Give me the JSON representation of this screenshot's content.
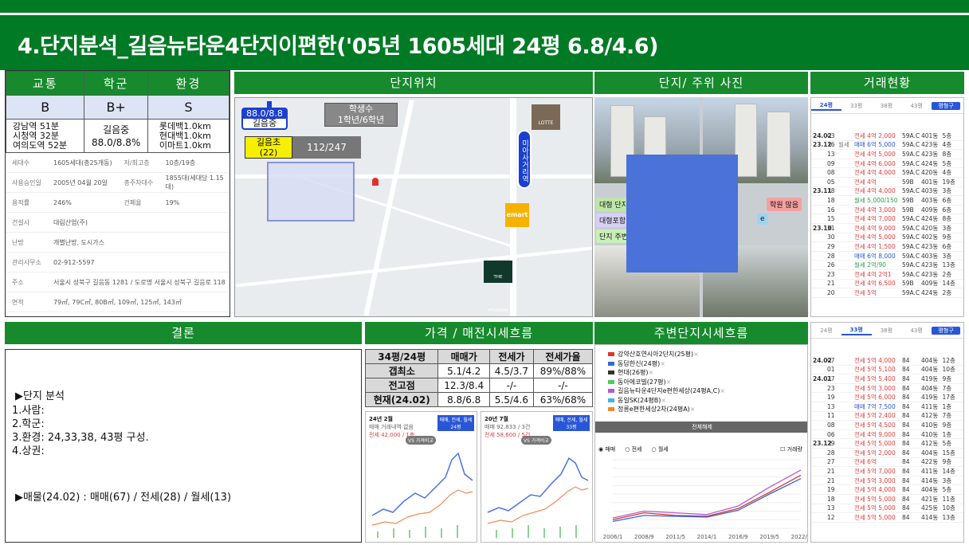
{
  "title": "4.단지분석_길음뉴타운4단지이편한('05년 1605세대 24평 6.8/4.6)",
  "grade": {
    "headers": [
      "교통",
      "학군",
      "환경"
    ],
    "grades": [
      "B",
      "B+",
      "S"
    ],
    "transport": [
      "강남역 51분",
      "시청역 32분",
      "여의도역 52분"
    ],
    "school": [
      "길음중",
      "88.0/8.8%"
    ],
    "environment": [
      "롯데백1.0km",
      "현대백1.0km",
      "이마트1.0km"
    ]
  },
  "complex_info": [
    {
      "k": "세대수",
      "v": "1605세대(총25개동)",
      "k2": "저/최고층",
      "v2": "10층/19층"
    },
    {
      "k": "사용승인일",
      "v": "2005년 04월 20일",
      "k2": "총주차대수",
      "v2": "1855대(세대당 1.15대)"
    },
    {
      "k": "용적률",
      "v": "246%",
      "k2": "건폐율",
      "v2": "19%"
    },
    {
      "k": "건설사",
      "v": "대림산업(주)",
      "k2": "",
      "v2": ""
    },
    {
      "k": "난방",
      "v": "개별난방, 도시가스",
      "k2": "",
      "v2": ""
    },
    {
      "k": "관리사무소",
      "v": "02-912-5597",
      "k2": "",
      "v2": ""
    },
    {
      "k": "주소",
      "v": "서울시 성북구 길음동 1281 / 도로명 서울시 성북구 길음로 118",
      "k2": "",
      "v2": ""
    },
    {
      "k": "면적",
      "v": "79㎡, 79C㎡, 80B㎡, 109㎡, 125㎡, 143㎡",
      "k2": "",
      "v2": ""
    }
  ],
  "sections": {
    "location": "단지위치",
    "photos": "단지/ 주위 사진",
    "trade": "거래현황",
    "conclusion": "결론",
    "price": "가격 / 매전시세흐름",
    "surround": "주변단지시세흐름"
  },
  "map": {
    "school_score": "88.0/8.8",
    "school_name": "길음중",
    "students_label": "학생수",
    "students": "1학년/6학년",
    "elem_name": "길음초",
    "elem_count": "(22)",
    "elem_ratio": "112/247",
    "station": "미아사거리역",
    "mart": "emart",
    "lotte": "LOTTE",
    "hyundai": "THE HYUNDAI"
  },
  "photo_labels": [
    "대형 단지",
    "대형포함",
    "단지 주변",
    "학원 많음",
    "e"
  ],
  "conclusion": {
    "heading": "▶단지 분석",
    "items": [
      "1.사람:",
      "2.학군:",
      "3.환경: 24,33,38, 43평 구성.",
      "4.상권:"
    ],
    "listing": "▶매물(24.02) : 매매(67) / 전세(28) / 월세(13)"
  },
  "price_table": {
    "headers": [
      "34평/24평",
      "매매가",
      "전세가",
      "전세가율"
    ],
    "rows": [
      [
        "갭최소",
        "5.1/4.2",
        "4.5/3.7",
        "89%/88%"
      ],
      [
        "전고점",
        "12.3/8.4",
        "-/-",
        "-/-"
      ],
      [
        "현재(24.02)",
        "8.8/6.8",
        "5.5/4.6",
        "63%/68%"
      ]
    ]
  },
  "mini1": {
    "head": "24년 2월",
    "sub": "매매 거래내역 없음",
    "price": "전세 42,000 / 1층",
    "btn": "매매, 전세, 월세",
    "btn2": "24평",
    "vs": "VS 가격비교"
  },
  "mini2": {
    "head": "20년 7월",
    "sub": "매매 92,833 / 3건",
    "price": "전세 58,600 / 5건",
    "btn": "매매, 전세, 월세",
    "btn2": "33평",
    "vs": "VS 가격비교"
  },
  "trade1": {
    "tabs": [
      "24평",
      "33평",
      "38평",
      "43평"
    ],
    "btn": "평형구",
    "rows": [
      [
        "24.02",
        "03",
        "",
        "전세 4억 2,000",
        "59A.C",
        "401동",
        "5층"
      ],
      [
        "23.12",
        "16",
        "월세",
        "매매 6억 5,000",
        "59A.C",
        "423동",
        "4층"
      ],
      [
        "",
        "13",
        "",
        "전세 4억 5,000",
        "59A.C",
        "423동",
        "8층"
      ],
      [
        "",
        "09",
        "",
        "전세 4억 6,000",
        "59A.C",
        "424동",
        "5층"
      ],
      [
        "",
        "08",
        "",
        "전세 4억 4,000",
        "59A.C",
        "420동",
        "4층"
      ],
      [
        "",
        "05",
        "",
        "전세 4억",
        "59B",
        "401동",
        "19층"
      ],
      [
        "23.11",
        "18",
        "",
        "전세 4억 4,000",
        "59A.C",
        "403동",
        "3층"
      ],
      [
        "",
        "18",
        "",
        "월세 5,000/150",
        "59B",
        "403동",
        "6층"
      ],
      [
        "",
        "16",
        "",
        "전세 4억 3,000",
        "59B",
        "409동",
        "6층"
      ],
      [
        "",
        "15",
        "",
        "전세 4억 7,000",
        "59A.C",
        "424동",
        "8층"
      ],
      [
        "23.10",
        "31",
        "",
        "전세 4억 9,000",
        "59A.C",
        "420동",
        "3층"
      ],
      [
        "",
        "30",
        "",
        "전세 4억 5,000",
        "59A.C",
        "402동",
        "9층"
      ],
      [
        "",
        "29",
        "",
        "전세 4억 1,500",
        "59A.C",
        "423동",
        "6층"
      ],
      [
        "",
        "28",
        "",
        "매매 6억 8,000",
        "59A.C",
        "403동",
        "3층"
      ],
      [
        "",
        "26",
        "",
        "월세 2억/90",
        "59A.C",
        "423동",
        "13층"
      ],
      [
        "",
        "23",
        "",
        "전세 4억 2억1",
        "59A.C",
        "423동",
        "2층"
      ],
      [
        "",
        "21",
        "",
        "전세 4억 6,500",
        "59B",
        "409동",
        "14층"
      ],
      [
        "",
        "20",
        "",
        "전세 5억",
        "59A.C",
        "424동",
        "2층"
      ]
    ]
  },
  "trade2": {
    "tabs": [
      "24평",
      "33평",
      "38평",
      "43평"
    ],
    "btn": "평형구",
    "rows": [
      [
        "24.02",
        "07",
        "",
        "전세 5억 4,000",
        "84",
        "404동",
        "12층"
      ],
      [
        "",
        "01",
        "",
        "전세 5억 5,100",
        "84",
        "404동",
        "10층"
      ],
      [
        "24.01",
        "27",
        "",
        "전세 5억 5,400",
        "84",
        "419동",
        "9층"
      ],
      [
        "",
        "23",
        "",
        "전세 5억 3,000",
        "84",
        "404동",
        "7층"
      ],
      [
        "",
        "19",
        "",
        "전세 5억 6,000",
        "84",
        "419동",
        "17층"
      ],
      [
        "",
        "13",
        "",
        "매매 7억 7,500",
        "84",
        "411동",
        "1층"
      ],
      [
        "",
        "11",
        "",
        "전세 5억 2,400",
        "84",
        "412동",
        "7층"
      ],
      [
        "",
        "08",
        "",
        "전세 5억 4,500",
        "84",
        "410동",
        "9층"
      ],
      [
        "",
        "06",
        "",
        "전세 4억 9,000",
        "84",
        "410동",
        "1층"
      ],
      [
        "23.12",
        "29",
        "",
        "전세 5억 5,000",
        "84",
        "412동",
        "5층"
      ],
      [
        "",
        "28",
        "",
        "전세 5억 2,000",
        "84",
        "404동",
        "15층"
      ],
      [
        "",
        "27",
        "",
        "전세 6억",
        "84",
        "422동",
        "9층"
      ],
      [
        "",
        "21",
        "",
        "전세 5억 7,000",
        "84",
        "411동",
        "14층"
      ],
      [
        "",
        "21",
        "",
        "전세 5억 3,000",
        "84",
        "414동",
        "3층"
      ],
      [
        "",
        "19",
        "",
        "전세 5억 4,000",
        "84",
        "404동",
        "5층"
      ],
      [
        "",
        "18",
        "",
        "전세 5억 5,000",
        "84",
        "421동",
        "11층"
      ],
      [
        "",
        "13",
        "",
        "전세 5억 5,000",
        "84",
        "425동",
        "10층"
      ],
      [
        "",
        "12",
        "",
        "전세 5억 5,000",
        "84",
        "414동",
        "13층"
      ]
    ]
  },
  "surround": {
    "legend": [
      "강약산호연시아2단지(25평)",
      "동답한신(24평)",
      "현대(26평)",
      "동아에코빌(27평)",
      "길음뉴타운4단지e편한세상(24평A,C)",
      "동일SK(24평B)",
      "정릉e편한세상2차(24평A)"
    ],
    "legend_colors": [
      "#e0332f",
      "#2f6bd8",
      "#333333",
      "#53c85a",
      "#b45ad0",
      "#3fb3e3",
      "#f08a2a"
    ],
    "btn": "전체해제",
    "radios": [
      "매매",
      "전세",
      "월세"
    ],
    "volume": "거래량",
    "xticks": [
      "2006/1",
      "2008/9",
      "2011/5",
      "2014/1",
      "2016/9",
      "2019/5",
      "2022/1"
    ]
  },
  "chart_data": {
    "type": "line",
    "x": [
      "2006/1",
      "2008/9",
      "2011/5",
      "2014/1",
      "2016/9",
      "2019/5",
      "2022/1"
    ],
    "series": [
      {
        "name": "길음뉴타운4단지e편한세상(24평A,C)",
        "values": [
          3.2,
          4.0,
          3.8,
          3.6,
          4.6,
          6.8,
          8.8
        ]
      },
      {
        "name": "강약산호연시아2단지(25평)",
        "values": [
          3.0,
          3.8,
          3.5,
          3.4,
          4.3,
          6.2,
          8.2
        ]
      },
      {
        "name": "동답한신(24평)",
        "values": [
          2.8,
          3.5,
          3.4,
          3.3,
          4.1,
          6.0,
          7.8
        ]
      }
    ]
  }
}
